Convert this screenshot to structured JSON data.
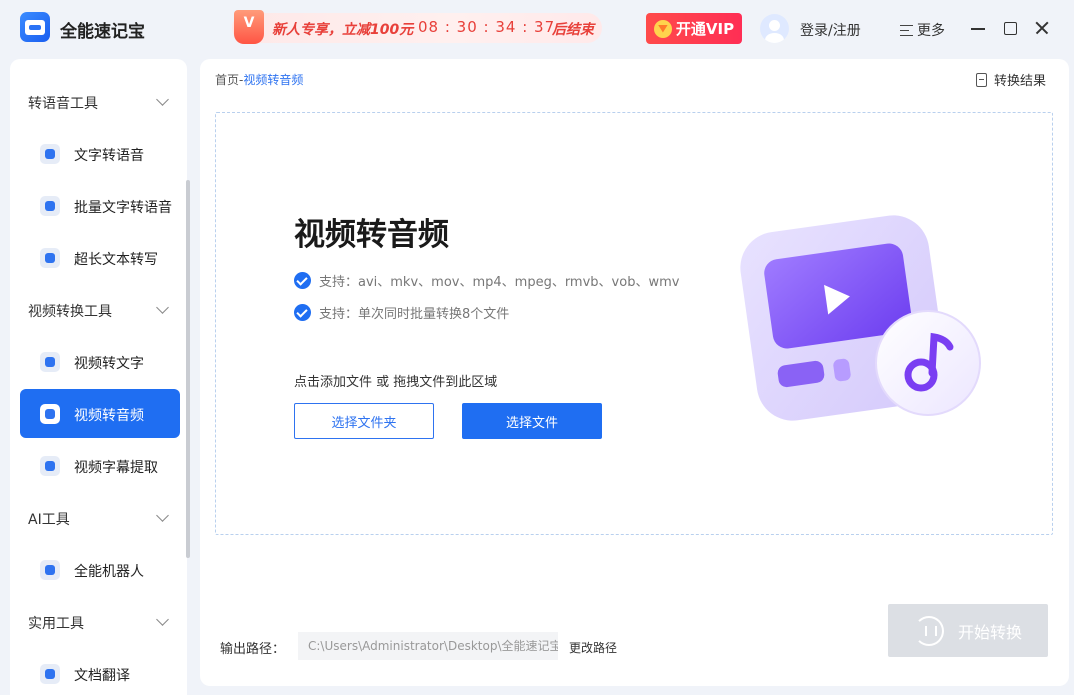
{
  "app": {
    "name": "全能速记宝",
    "icon": "app-logo-icon"
  },
  "promo": {
    "badge": "V",
    "text": "新人专享，立减100元",
    "timer": "08 : 30 : 34 : 37",
    "end_label": "后结束"
  },
  "header": {
    "vip_label": "开通VIP",
    "login_label": "登录/注册",
    "more_label": "更多"
  },
  "sidebar": {
    "groups": [
      {
        "label": "转语音工具"
      },
      {
        "label": "视频转换工具"
      },
      {
        "label": "AI工具"
      },
      {
        "label": "实用工具"
      }
    ],
    "items": [
      {
        "label": "文字转语音",
        "icon": "audio-file-icon"
      },
      {
        "label": "批量文字转语音",
        "icon": "batch-audio-icon"
      },
      {
        "label": "超长文本转写",
        "icon": "long-text-icon"
      },
      {
        "label": "视频转文字",
        "icon": "video-text-icon"
      },
      {
        "label": "视频转音频",
        "icon": "video-audio-icon",
        "active": true
      },
      {
        "label": "视频字幕提取",
        "icon": "subtitle-extract-icon"
      },
      {
        "label": "全能机器人",
        "icon": "robot-icon"
      },
      {
        "label": "文档翻译",
        "icon": "translate-icon"
      }
    ]
  },
  "main": {
    "breadcrumb_home": "首页",
    "breadcrumb_sep": "-",
    "breadcrumb_current": "视频转音频",
    "result_label": "转换结果",
    "title": "视频转音频",
    "support_formats": "支持：avi、mkv、mov、mp4、mpeg、rmvb、vob、wmv",
    "support_batch": "支持：单次同时批量转换8个文件",
    "hint": "点击添加文件 或 拖拽文件到此区域",
    "btn_folder": "选择文件夹",
    "btn_file": "选择文件",
    "output_label": "输出路径：",
    "output_path": "C:\\Users\\Administrator\\Desktop\\全能速记宝",
    "change_path": "更改路径",
    "start_label": "开始转换"
  },
  "colors": {
    "accent": "#1f6ef2",
    "promo": "#e8403a",
    "vip": "#ff3b4e",
    "illustration": "#8b5cf6"
  }
}
